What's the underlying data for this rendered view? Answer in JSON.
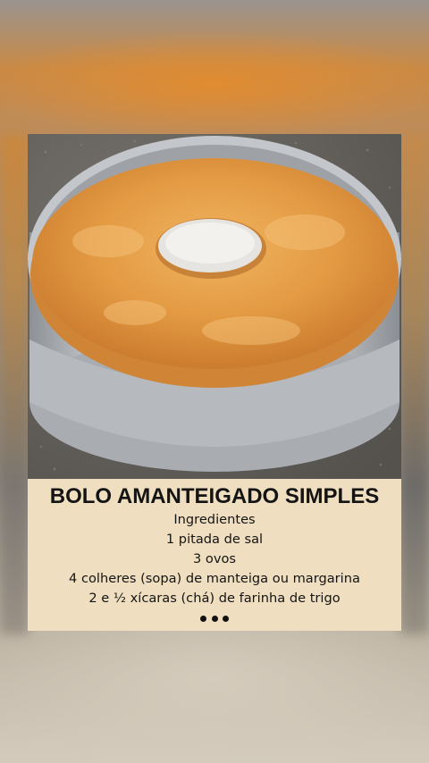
{
  "post": {
    "image_description_name": "bundt-cake-in-pan",
    "title": "BOLO AMANTEIGADO SIMPLES",
    "ingredients_heading": "Ingredientes",
    "ingredients": [
      "1 pitada de sal",
      "3 ovos",
      "4 colheres (sopa) de manteiga ou margarina",
      "2 e ½ xícaras (chá) de farinha de trigo"
    ],
    "more_indicator": "more-dots"
  },
  "colors": {
    "caption_background": "#efdfc0",
    "text": "#141414",
    "cake": "#e0953e",
    "pan": "#b8bcc1"
  }
}
